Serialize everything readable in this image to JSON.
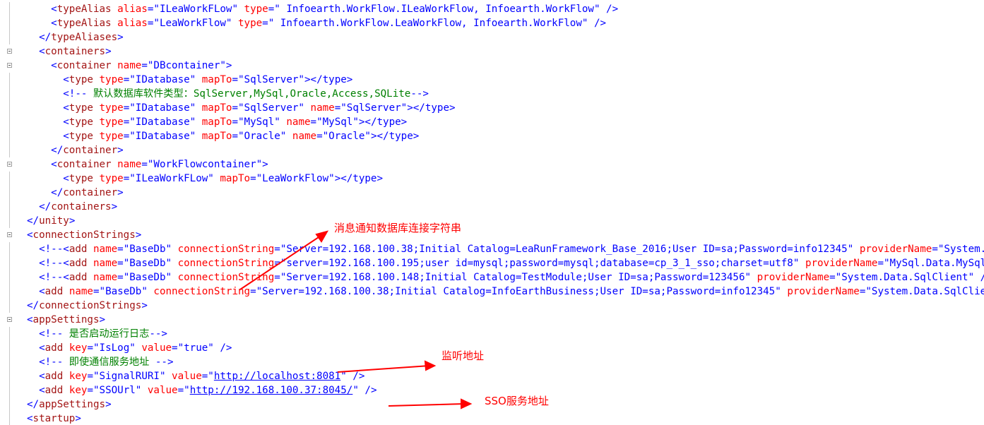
{
  "code_lines": [
    "    <typeAlias alias=\"ILeaWorkFLow\" type=\" Infoearth.WorkFlow.ILeaWorkFlow, Infoearth.WorkFlow\" />",
    "    <typeAlias alias=\"LeaWorkFlow\" type=\" Infoearth.WorkFlow.LeaWorkFlow, Infoearth.WorkFlow\" />",
    "  </typeAliases>",
    "  <containers>",
    "    <container name=\"DBcontainer\">",
    "      <type type=\"IDatabase\" mapTo=\"SqlServer\"></type>",
    "      <!-- 默认数据库软件类型：SqlServer,MySql,Oracle,Access,SQLite-->",
    "      <type type=\"IDatabase\" mapTo=\"SqlServer\" name=\"SqlServer\"></type>",
    "      <type type=\"IDatabase\" mapTo=\"MySql\" name=\"MySql\"></type>",
    "      <type type=\"IDatabase\" mapTo=\"Oracle\" name=\"Oracle\"></type>",
    "    </container>",
    "    <container name=\"WorkFlowcontainer\">",
    "      <type type=\"ILeaWorkFLow\" mapTo=\"LeaWorkFlow\"></type>",
    "    </container>",
    "  </containers>",
    "</unity>",
    "<connectionStrings>",
    "  <!--<add name=\"BaseDb\" connectionString=\"Server=192.168.100.38;Initial Catalog=LeaRunFramework_Base_2016;User ID=sa;Password=info12345\" providerName=\"System.Data.SqlClient\" />-->",
    "  <!--<add name=\"BaseDb\" connectionString=\"server=192.168.100.195;user id=mysql;password=mysql;database=cp_3_1_sso;charset=utf8\" providerName=\"MySql.Data.MySqlClient\" />-->",
    "  <!--<add name=\"BaseDb\" connectionString=\"Server=192.168.100.148;Initial Catalog=TestModule;User ID=sa;Password=123456\" providerName=\"System.Data.SqlClient\" />-->",
    "  <add name=\"BaseDb\" connectionString=\"Server=192.168.100.38;Initial Catalog=InfoEarthBusiness;User ID=sa;Password=info12345\" providerName=\"System.Data.SqlClient\" />",
    "</connectionStrings>",
    "<appSettings>",
    "  <!-- 是否启动运行日志-->",
    "  <add key=\"IsLog\" value=\"true\" />",
    "  <!-- 即使通信服务地址 -->",
    "  <add key=\"SignalRURI\" value=\"http://localhost:8081\" />",
    "  <add key=\"SSOUrl\" value=\"http://192.168.100.37:8045/\" />",
    "</appSettings>",
    "<startup>"
  ],
  "fold_lines": [
    3,
    4,
    11,
    16,
    22
  ],
  "annotations": {
    "connection_note": "消息通知数据库连接字符串",
    "listen_note": "监听地址",
    "sso_note": "SSO服务地址"
  },
  "colors": {
    "tag": "#a31515",
    "bracket": "#0000ff",
    "attr_name": "#ff0000",
    "attr_value": "#0000ff",
    "comment": "#008000",
    "annotation": "#ff0000"
  }
}
